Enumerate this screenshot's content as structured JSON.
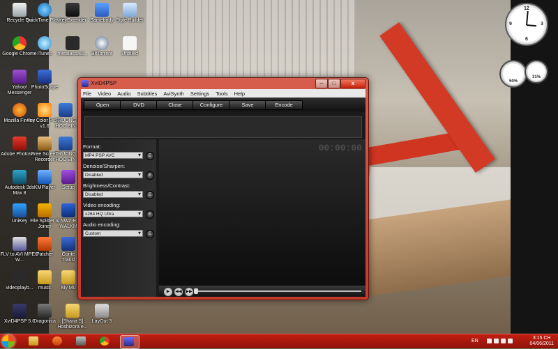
{
  "desktop": {
    "icons": [
      {
        "label": "Recycle Bin",
        "icon": "recycle-bin-icon"
      },
      {
        "label": "QuickTime Player",
        "icon": "quicktime-icon"
      },
      {
        "label": "KeyExtender",
        "icon": "keyextender-icon"
      },
      {
        "label": "Samebody",
        "icon": "samebody-icon"
      },
      {
        "label": "Style Builder",
        "icon": "style-builder-icon"
      },
      {
        "label": "Google Chrome",
        "icon": "chrome-icon"
      },
      {
        "label": "iTunes",
        "icon": "itunes-icon"
      },
      {
        "label": "metalassaul...",
        "icon": "metal-icon"
      },
      {
        "label": "BitTorrent",
        "icon": "bittorrent-icon"
      },
      {
        "label": "Untitled",
        "icon": "untitled-icon"
      },
      {
        "label": "Yahoo! Messenger",
        "icon": "yahoo-icon"
      },
      {
        "label": "PhotoScape",
        "icon": "photoscape-icon"
      },
      {
        "label": "Mozilla Firefox",
        "icon": "firefox-icon"
      },
      {
        "label": "Any Color Picker v1.6",
        "icon": "color-picker-icon"
      },
      {
        "label": "TRUONG HOC BIN",
        "icon": "word-doc-icon"
      },
      {
        "label": "Adobe Photosh...",
        "icon": "photoshop-icon"
      },
      {
        "label": "Free Screen Recorder",
        "icon": "screen-recorder-icon"
      },
      {
        "label": "TRUONG HOC BIN",
        "icon": "word-doc-icon"
      },
      {
        "label": "Autodesk 3ds Max 8",
        "icon": "3dsmax-icon"
      },
      {
        "label": "KMPlayer",
        "icon": "kmplayer-icon"
      },
      {
        "label": "Setup",
        "icon": "setup-icon"
      },
      {
        "label": "UniKey",
        "icon": "unikey-icon"
      },
      {
        "label": "File Splitter & Joiner",
        "icon": "file-splitter-icon"
      },
      {
        "label": "NWZ-E WALKM",
        "icon": "walkman-icon"
      },
      {
        "label": "FLV to AVI MPEG W...",
        "icon": "flv-converter-icon"
      },
      {
        "label": "Patcher",
        "icon": "patcher-icon"
      },
      {
        "label": "Conte Transl",
        "icon": "context-icon"
      },
      {
        "label": "videoplayb...",
        "icon": "video-file-icon"
      },
      {
        "label": "music",
        "icon": "folder-icon"
      },
      {
        "label": "My Mu",
        "icon": "folder-icon"
      },
      {
        "label": "XviD4PSP 5.0",
        "icon": "xvid4psp-icon"
      },
      {
        "label": "Dragonica",
        "icon": "dragonica-icon"
      },
      {
        "label": "[Shana S] Hoshizora e...",
        "icon": "folder-icon"
      },
      {
        "label": "LayOut 3",
        "icon": "layout-icon"
      }
    ]
  },
  "gadgets": {
    "clock": {
      "numbers": [
        "12",
        "3",
        "6",
        "9"
      ]
    },
    "cpu_meter": {
      "label": "50%"
    },
    "ram_meter": {
      "label": "31%"
    }
  },
  "window": {
    "title": "XviD4PSP",
    "controls": {
      "minimize": "–",
      "maximize": "□",
      "close": "x"
    },
    "menu": [
      "File",
      "Video",
      "Audio",
      "Subtitles",
      "AviSynth",
      "Settings",
      "Tools",
      "Help"
    ],
    "toolbar": [
      "Open",
      "DVD",
      "Close",
      "Configure",
      "Save",
      "Encode"
    ],
    "timecode": "00:00:00",
    "settings": [
      {
        "label": "Format:",
        "value": "MP4 PSP AVC",
        "edit": "E"
      },
      {
        "label": "Denoise/Sharpen:",
        "value": "Disabled",
        "edit": "E"
      },
      {
        "label": "Brightness/Contrast:",
        "value": "Disabled",
        "edit": "E"
      },
      {
        "label": "Video encoding:",
        "value": "x264 HQ Ultra",
        "edit": "E"
      },
      {
        "label": "Audio encoding:",
        "value": "Custom",
        "edit": "E"
      }
    ],
    "player": {
      "play": "▶",
      "prev": "◀◀",
      "next": "▶▶"
    }
  },
  "taskbar": {
    "buttons": [
      {
        "icon": "explorer-icon"
      },
      {
        "icon": "media-player-icon"
      },
      {
        "icon": "gimp-icon"
      },
      {
        "icon": "chrome-icon"
      },
      {
        "icon": "xvid4psp-icon"
      }
    ],
    "language": "EN",
    "time": "3:15 CH",
    "date": "04/06/2011"
  }
}
